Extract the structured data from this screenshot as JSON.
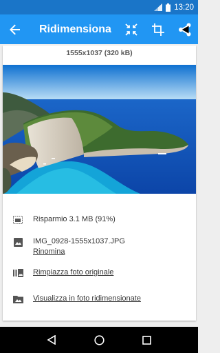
{
  "status": {
    "time": "13:20"
  },
  "appbar": {
    "title": "Ridimensiona"
  },
  "card": {
    "dimensions": "1555x1037 (320 kB)",
    "savings": "Risparmio 3.1 MB (91%)",
    "filename": "IMG_0928-1555x1037.JPG",
    "rename": "Rinomina",
    "replace": "Rimpiazza foto originale",
    "view": "Visualizza in foto ridimensionate"
  },
  "colors": {
    "statusbar": "#1a75c8",
    "appbar": "#2196f3"
  },
  "icons": [
    "back-arrow-icon",
    "compress-icon",
    "crop-icon",
    "share-icon"
  ]
}
